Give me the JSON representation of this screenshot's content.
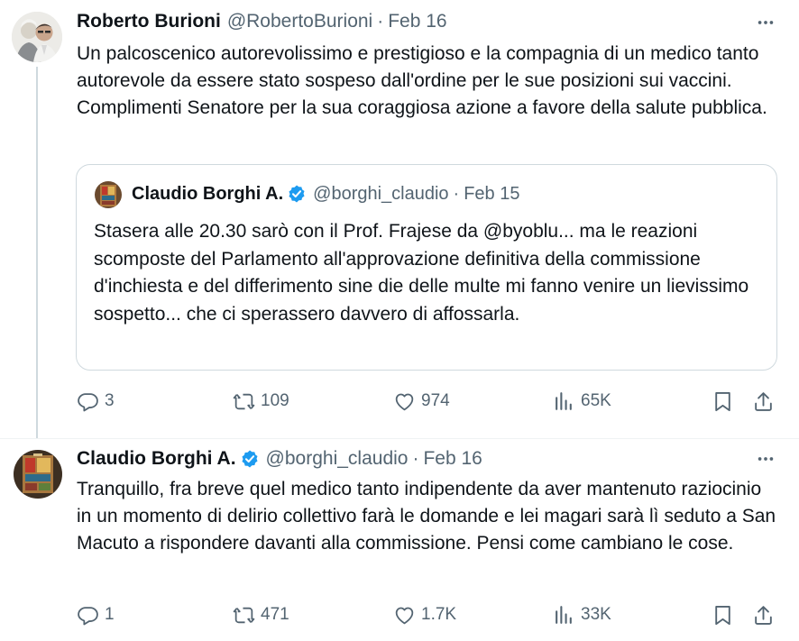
{
  "tweets": [
    {
      "author": {
        "name": "Roberto Burioni",
        "handle": "@RobertoBurioni",
        "verified": false
      },
      "separator": "·",
      "date": "Feb 16",
      "text": "Un palcoscenico autorevolissimo e prestigioso e la compagnia di un medico tanto autorevole da essere stato sospeso dall'ordine per le sue posizioni sui vaccini. Complimenti Senatore per la sua coraggiosa azione a favore della salute pubblica.",
      "quote": {
        "author": {
          "name": "Claudio Borghi A.",
          "handle": "@borghi_claudio",
          "verified": true
        },
        "separator": "·",
        "date": "Feb 15",
        "text": "Stasera alle 20.30 sarò con il Prof. Frajese da @byoblu... ma le reazioni scomposte del Parlamento all'approvazione definitiva della commissione d'inchiesta e del differimento sine die delle multe mi fanno venire un lievissimo sospetto... che ci sperassero davvero di affossarla."
      },
      "stats": {
        "replies": "3",
        "retweets": "109",
        "likes": "974",
        "views": "65K"
      }
    },
    {
      "author": {
        "name": "Claudio Borghi A.",
        "handle": "@borghi_claudio",
        "verified": true
      },
      "separator": "·",
      "date": "Feb 16",
      "text": "Tranquillo, fra breve quel medico tanto indipendente da aver mantenuto raziocinio in un momento di delirio collettivo farà le domande e lei magari sarà lì seduto a San Macuto a rispondere davanti alla commissione. Pensi come cambiano le cose.",
      "stats": {
        "replies": "1",
        "retweets": "471",
        "likes": "1.7K",
        "views": "33K"
      }
    }
  ],
  "colors": {
    "text_primary": "#0f1419",
    "text_secondary": "#536471",
    "verified_badge": "#1d9bf0",
    "border": "#cfd9de",
    "divider": "#eff3f4"
  },
  "icons": [
    "more-icon",
    "verified-icon",
    "reply-icon",
    "retweet-icon",
    "like-icon",
    "views-icon",
    "bookmark-icon",
    "share-icon"
  ]
}
